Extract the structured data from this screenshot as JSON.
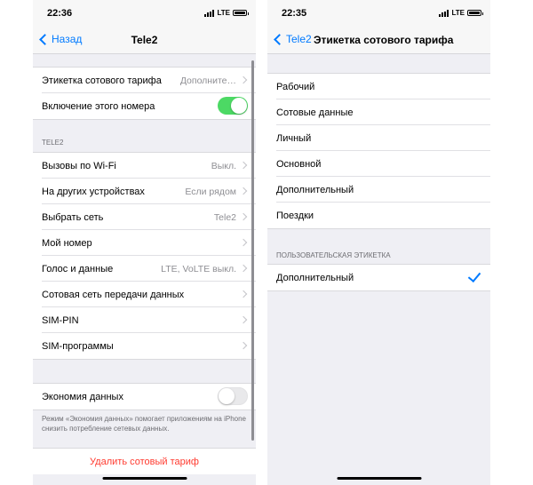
{
  "left": {
    "status": {
      "time": "22:36",
      "network": "LTE"
    },
    "nav": {
      "back_label": "Назад",
      "title": "Tele2"
    },
    "group1": [
      {
        "label": "Этикетка сотового тарифа",
        "value": "Дополните…"
      },
      {
        "label": "Включение этого номера",
        "switch": "on"
      }
    ],
    "section_header": "TELE2",
    "group2": [
      {
        "label": "Вызовы по Wi-Fi",
        "value": "Выкл."
      },
      {
        "label": "На других устройствах",
        "value": "Если рядом"
      },
      {
        "label": "Выбрать сеть",
        "value": "Tele2"
      },
      {
        "label": "Мой номер",
        "value": ""
      },
      {
        "label": "Голос и данные",
        "value": "LTE, VoLTE выкл."
      },
      {
        "label": "Сотовая сеть передачи данных",
        "value": ""
      },
      {
        "label": "SIM-PIN",
        "value": ""
      },
      {
        "label": "SIM-программы",
        "value": ""
      }
    ],
    "group3": [
      {
        "label": "Экономия данных",
        "switch": "off"
      }
    ],
    "data_saver_note": "Режим «Экономия данных» помогает приложениям на iPhone снизить потребление сетевых данных.",
    "delete_label": "Удалить сотовый тариф"
  },
  "right": {
    "status": {
      "time": "22:35",
      "network": "LTE"
    },
    "nav": {
      "back_label": "Tele2",
      "title": "Этикетка сотового тарифа"
    },
    "labels": [
      "Рабочий",
      "Сотовые данные",
      "Личный",
      "Основной",
      "Дополнительный",
      "Поездки"
    ],
    "custom_header": "ПОЛЬЗОВАТЕЛЬСКАЯ ЭТИКЕТКА",
    "custom_label": "Дополнительный",
    "custom_selected": true
  },
  "colors": {
    "accent": "#007aff",
    "switch_on": "#4cd964",
    "destructive": "#ff3b30",
    "background": "#efeff4"
  },
  "icons": [
    "back-chevron-icon",
    "chevron-right-icon",
    "checkmark-icon",
    "signal-icon",
    "battery-icon"
  ]
}
